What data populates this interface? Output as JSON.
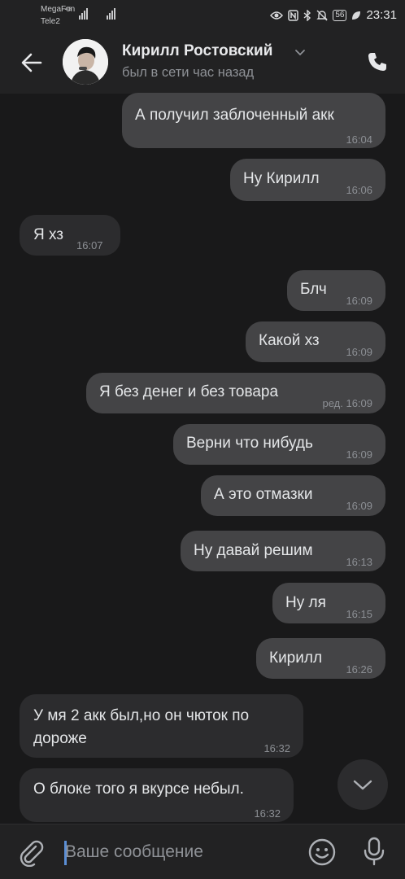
{
  "status_bar": {
    "carrier1": "MegaFon",
    "carrier2": "Tele2",
    "network": "4G",
    "battery": "56",
    "time": "23:31",
    "icons": [
      "eye-icon",
      "nfc-icon",
      "bluetooth-icon",
      "mute-icon",
      "battery-icon",
      "leaf-icon"
    ]
  },
  "header": {
    "contact_name": "Кирилл Ростовский",
    "contact_status": "был в сети час назад"
  },
  "messages": [
    {
      "dir": "out",
      "text": "А получил заблоченный акк",
      "time": "16:04"
    },
    {
      "dir": "out",
      "text": "Ну Кирилл",
      "time": "16:06"
    },
    {
      "dir": "in",
      "text": "Я хз",
      "time": "16:07"
    },
    {
      "dir": "out",
      "text": "Блч",
      "time": "16:09"
    },
    {
      "dir": "out",
      "text": "Какой хз",
      "time": "16:09"
    },
    {
      "dir": "out",
      "text": "Я без денег и без товара",
      "time": "ред. 16:09"
    },
    {
      "dir": "out",
      "text": "Верни что нибудь",
      "time": "16:09"
    },
    {
      "dir": "out",
      "text": "А это отмазки",
      "time": "16:09"
    },
    {
      "dir": "out",
      "text": "Ну давай решим",
      "time": "16:13"
    },
    {
      "dir": "out",
      "text": "Ну ля",
      "time": "16:15"
    },
    {
      "dir": "out",
      "text": "Кирилл",
      "time": "16:26"
    },
    {
      "dir": "in",
      "text": "У мя 2 акк был,но он чюток по дороже",
      "time": "16:32"
    },
    {
      "dir": "in",
      "text": "О блоке того я вкурсе небыл.",
      "time": "16:32"
    }
  ],
  "composer": {
    "placeholder": "Ваше сообщение"
  }
}
